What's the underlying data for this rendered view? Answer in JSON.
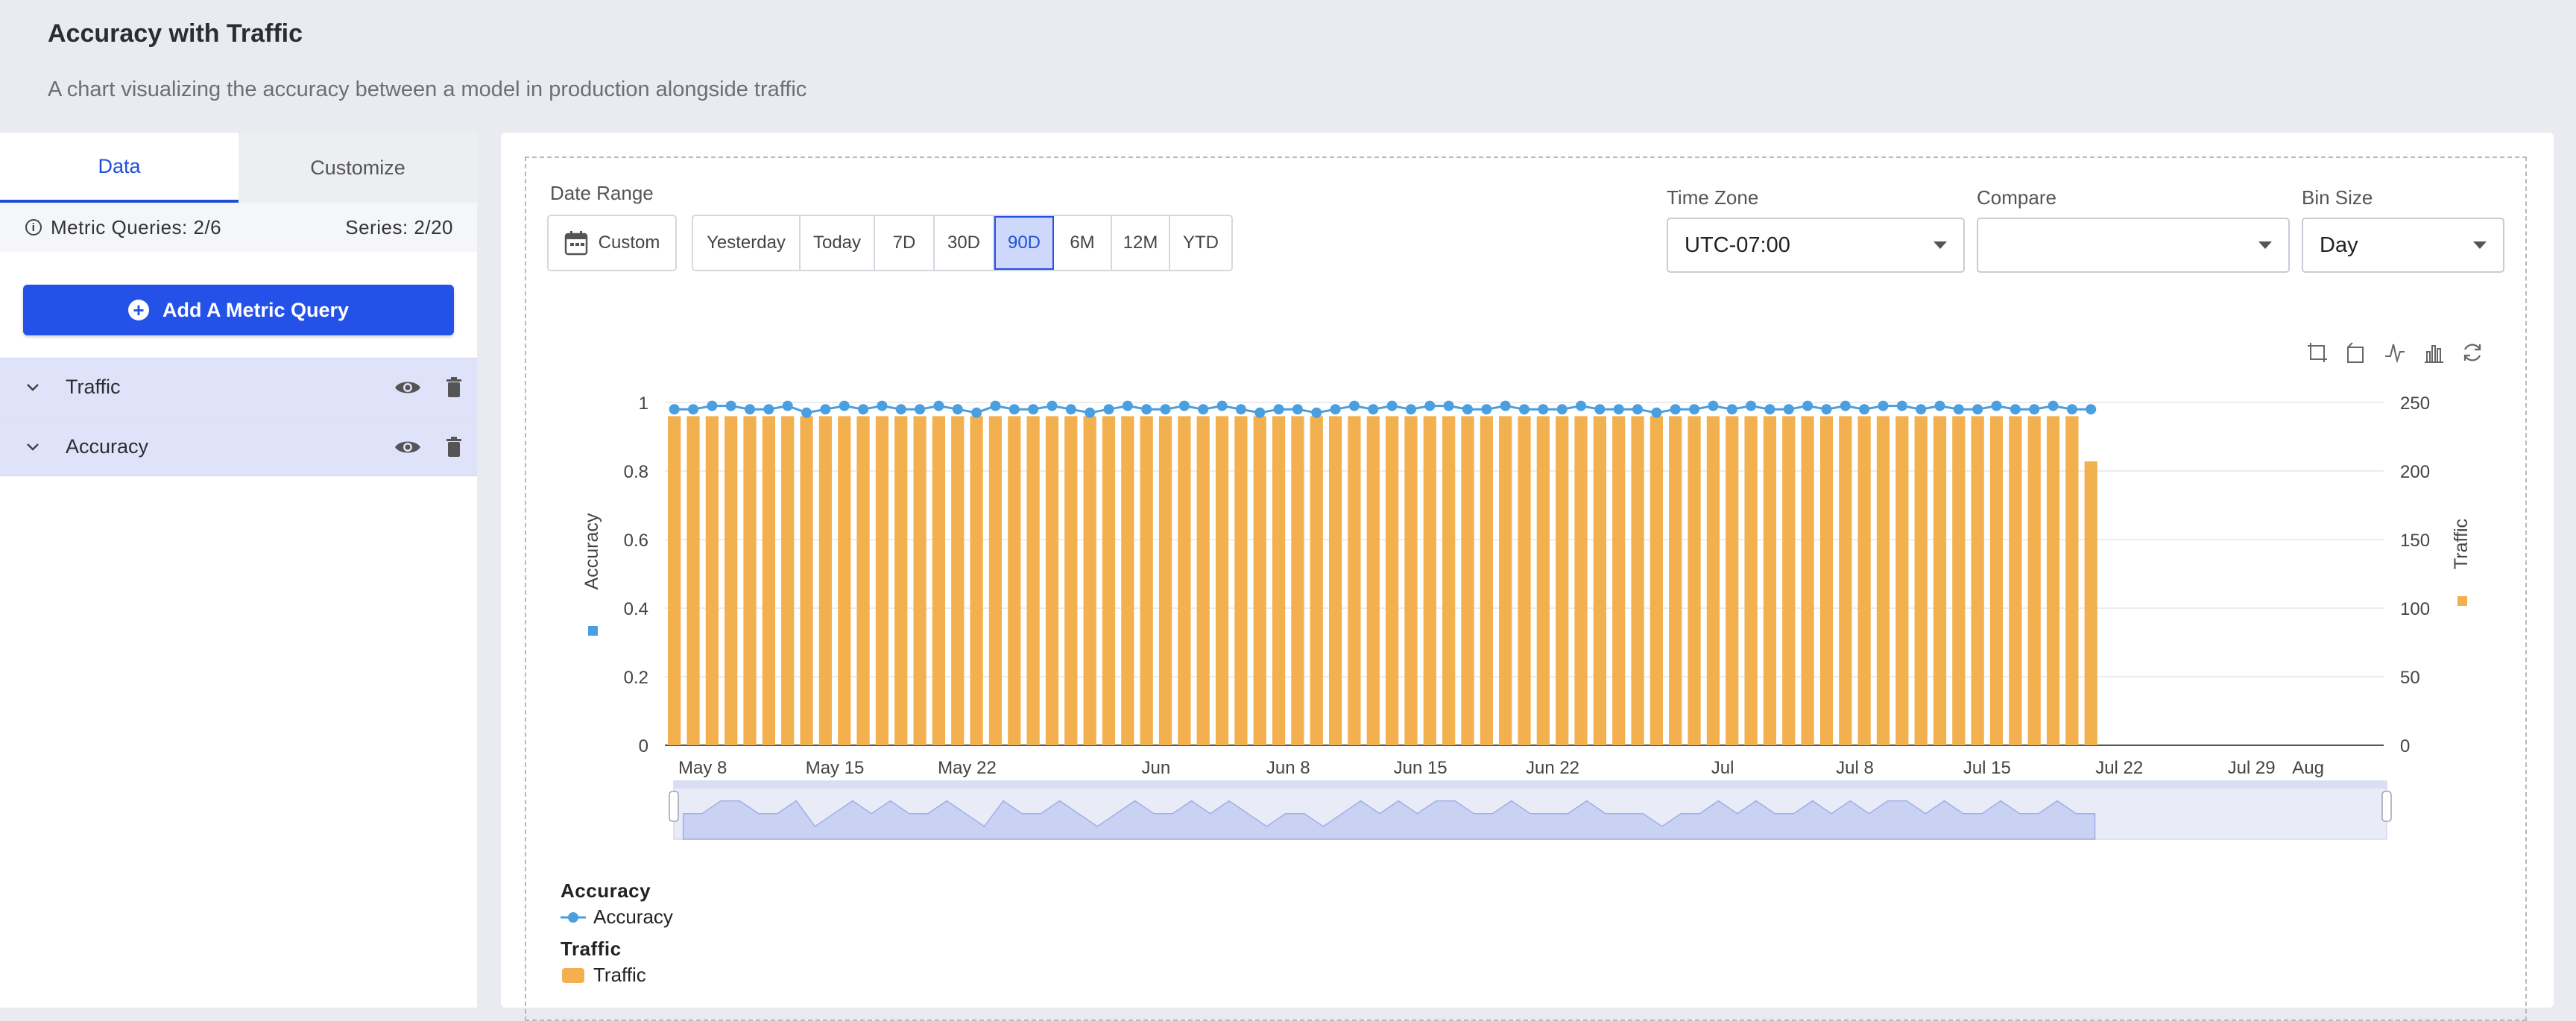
{
  "page": {
    "title": "Accuracy with Traffic",
    "subtitle": "A chart visualizing the accuracy between a model in production alongside traffic"
  },
  "left": {
    "tabs": [
      {
        "label": "Data"
      },
      {
        "label": "Customize"
      }
    ],
    "metric_queries": "Metric Queries: 2/6",
    "series": "Series: 2/20",
    "add_button": "Add A Metric Query",
    "queries": [
      {
        "label": "Traffic"
      },
      {
        "label": "Accuracy"
      }
    ]
  },
  "controls": {
    "date_range_label": "Date Range",
    "custom_label": "Custom",
    "ranges": [
      "Yesterday",
      "Today",
      "7D",
      "30D",
      "90D",
      "6M",
      "12M",
      "YTD"
    ],
    "active_range": "90D",
    "time_zone_label": "Time Zone",
    "time_zone_value": "UTC-07:00",
    "compare_label": "Compare",
    "compare_value": "",
    "bin_size_label": "Bin Size",
    "bin_size_value": "Day"
  },
  "colors": {
    "accuracy": "#4a9fe0",
    "traffic": "#f2b04f",
    "accent": "#2451e8"
  },
  "chart_data": {
    "type": "bar+line",
    "x_tick_labels": [
      "May 8",
      "May 15",
      "May 22",
      "Jun",
      "Jun 8",
      "Jun 15",
      "Jun 22",
      "Jul",
      "Jul 8",
      "Jul 15",
      "Jul 22",
      "Jul 29",
      "Aug"
    ],
    "x_range": [
      "2024-05-06",
      "2024-08-05"
    ],
    "left_axis": {
      "label": "Accuracy",
      "ticks": [
        "0",
        "0.2",
        "0.4",
        "0.6",
        "0.8",
        "1"
      ],
      "ylim": [
        0,
        1
      ]
    },
    "right_axis": {
      "label": "Traffic",
      "ticks": [
        "0",
        "50",
        "100",
        "150",
        "200",
        "250"
      ],
      "ylim": [
        0,
        250
      ]
    },
    "grid": true,
    "legend_position": "bottom-left",
    "series": [
      {
        "name": "Traffic",
        "type": "bar",
        "start_date": "2024-05-06",
        "values": [
          240,
          240,
          240,
          240,
          240,
          240,
          240,
          240,
          240,
          240,
          240,
          240,
          240,
          240,
          240,
          240,
          240,
          240,
          240,
          240,
          240,
          240,
          240,
          240,
          240,
          240,
          240,
          240,
          240,
          240,
          240,
          240,
          240,
          240,
          240,
          240,
          240,
          240,
          240,
          240,
          240,
          240,
          240,
          240,
          240,
          240,
          240,
          240,
          240,
          240,
          240,
          240,
          240,
          240,
          240,
          240,
          240,
          240,
          240,
          240,
          240,
          240,
          240,
          240,
          240,
          240,
          240,
          240,
          240,
          240,
          240,
          240,
          240,
          240,
          240,
          207
        ]
      },
      {
        "name": "Accuracy",
        "type": "line",
        "start_date": "2024-05-06",
        "values": [
          0.98,
          0.98,
          0.99,
          0.99,
          0.98,
          0.98,
          0.99,
          0.97,
          0.98,
          0.99,
          0.98,
          0.99,
          0.98,
          0.98,
          0.99,
          0.98,
          0.97,
          0.99,
          0.98,
          0.98,
          0.99,
          0.98,
          0.97,
          0.98,
          0.99,
          0.98,
          0.98,
          0.99,
          0.98,
          0.99,
          0.98,
          0.97,
          0.98,
          0.98,
          0.97,
          0.98,
          0.99,
          0.98,
          0.99,
          0.98,
          0.99,
          0.99,
          0.98,
          0.98,
          0.99,
          0.98,
          0.98,
          0.98,
          0.99,
          0.98,
          0.98,
          0.98,
          0.97,
          0.98,
          0.98,
          0.99,
          0.98,
          0.99,
          0.98,
          0.98,
          0.99,
          0.98,
          0.99,
          0.98,
          0.99,
          0.99,
          0.98,
          0.99,
          0.98,
          0.98,
          0.99,
          0.98,
          0.98,
          0.99,
          0.98,
          0.98
        ]
      }
    ],
    "legend": [
      {
        "group": "Accuracy",
        "item": "Accuracy"
      },
      {
        "group": "Traffic",
        "item": "Traffic"
      }
    ]
  }
}
